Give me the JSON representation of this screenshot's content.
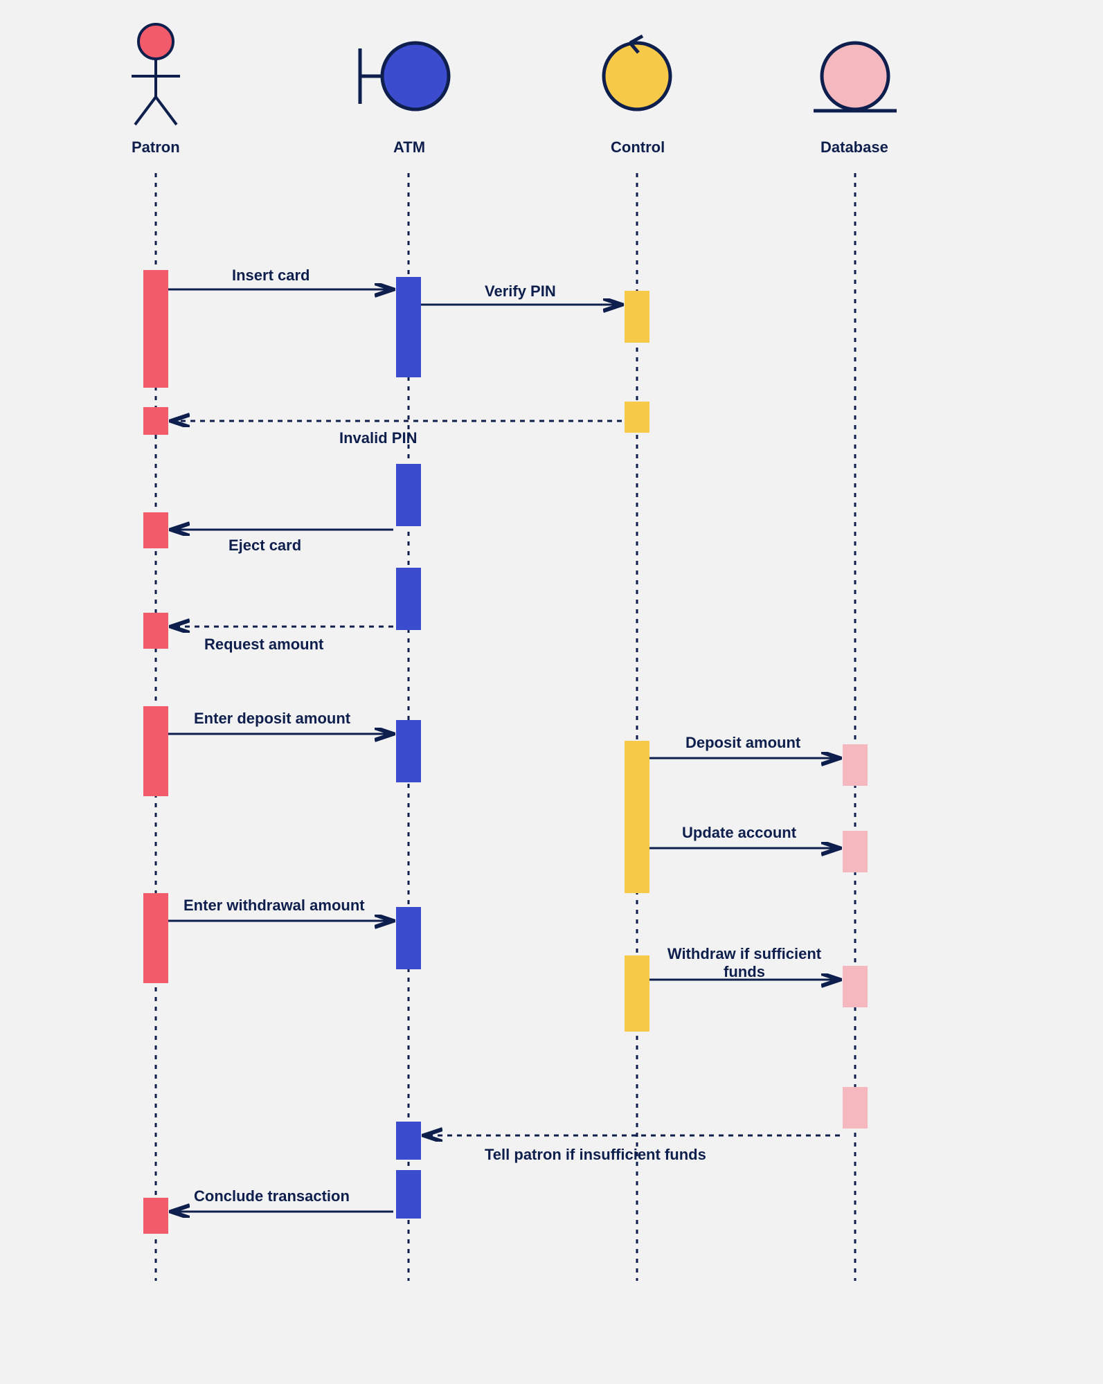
{
  "participants": {
    "patron": "Patron",
    "atm": "ATM",
    "control": "Control",
    "database": "Database"
  },
  "messages": {
    "insert_card": "Insert card",
    "verify_pin": "Verify PIN",
    "invalid_pin": "Invalid PIN",
    "eject_card": "Eject card",
    "request_amount": "Request amount",
    "enter_deposit": "Enter deposit amount",
    "deposit_amount": "Deposit amount",
    "update_account": "Update account",
    "enter_withdrawal": "Enter withdrawal amount",
    "withdraw_if_sufficient": "Withdraw if sufficient funds",
    "tell_insufficient": "Tell patron if insufficient funds",
    "conclude": "Conclude transaction"
  },
  "colors": {
    "patron": "#f25c6a",
    "atm": "#3b4ccf",
    "control": "#f7c948",
    "database": "#f5b8bf",
    "line": "#0e1f4d",
    "bg": "#f2f2f2"
  },
  "chart_data": {
    "type": "sequence-diagram",
    "participants": [
      "Patron",
      "ATM",
      "Control",
      "Database"
    ],
    "messages": [
      {
        "from": "Patron",
        "to": "ATM",
        "label": "Insert card",
        "style": "solid"
      },
      {
        "from": "ATM",
        "to": "Control",
        "label": "Verify PIN",
        "style": "solid"
      },
      {
        "from": "Control",
        "to": "Patron",
        "label": "Invalid PIN",
        "style": "dashed"
      },
      {
        "from": "ATM",
        "to": "Patron",
        "label": "Eject card",
        "style": "solid"
      },
      {
        "from": "ATM",
        "to": "Patron",
        "label": "Request amount",
        "style": "dashed"
      },
      {
        "from": "Patron",
        "to": "ATM",
        "label": "Enter deposit amount",
        "style": "solid"
      },
      {
        "from": "Control",
        "to": "Database",
        "label": "Deposit amount",
        "style": "solid"
      },
      {
        "from": "Control",
        "to": "Database",
        "label": "Update account",
        "style": "solid"
      },
      {
        "from": "Patron",
        "to": "ATM",
        "label": "Enter withdrawal amount",
        "style": "solid"
      },
      {
        "from": "Control",
        "to": "Database",
        "label": "Withdraw if sufficient funds",
        "style": "solid"
      },
      {
        "from": "Database",
        "to": "ATM",
        "label": "Tell patron if insufficient funds",
        "style": "dashed"
      },
      {
        "from": "ATM",
        "to": "Patron",
        "label": "Conclude transaction",
        "style": "solid"
      }
    ]
  }
}
